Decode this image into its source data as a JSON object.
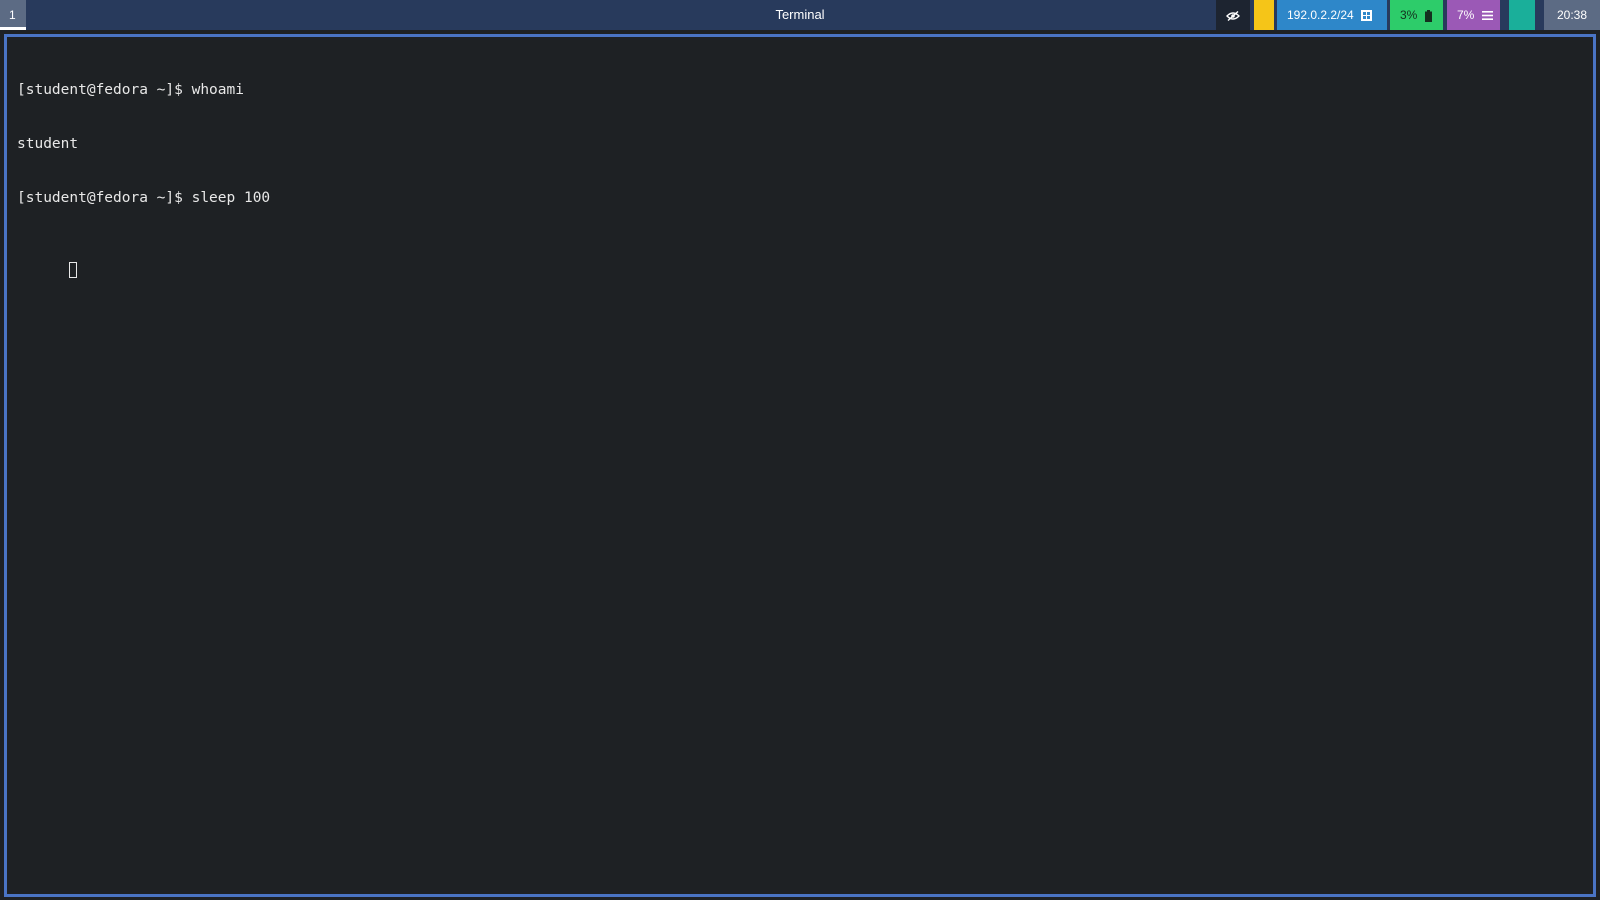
{
  "topbar": {
    "workspace": "1",
    "window_title": "Terminal",
    "network": "192.0.2.2/24",
    "battery": "3%",
    "cpu": "7%",
    "clock": "20:38",
    "icons": {
      "privacy": "eye-slash-icon",
      "network": "network-icon",
      "battery": "battery-icon",
      "cpu": "menu-lines-icon"
    },
    "colors": {
      "bar_bg": "#283a5c",
      "yellow": "#f5c518",
      "network": "#2e87c9",
      "battery": "#2dcc6a",
      "cpu": "#9b59b6",
      "teal": "#1aaf9a",
      "clock": "#5c6b84"
    }
  },
  "terminal": {
    "lines": [
      "[student@fedora ~]$ whoami",
      "student",
      "[student@fedora ~]$ sleep 100"
    ],
    "border_color": "#4a74c4",
    "bg_color": "#1e2124"
  }
}
